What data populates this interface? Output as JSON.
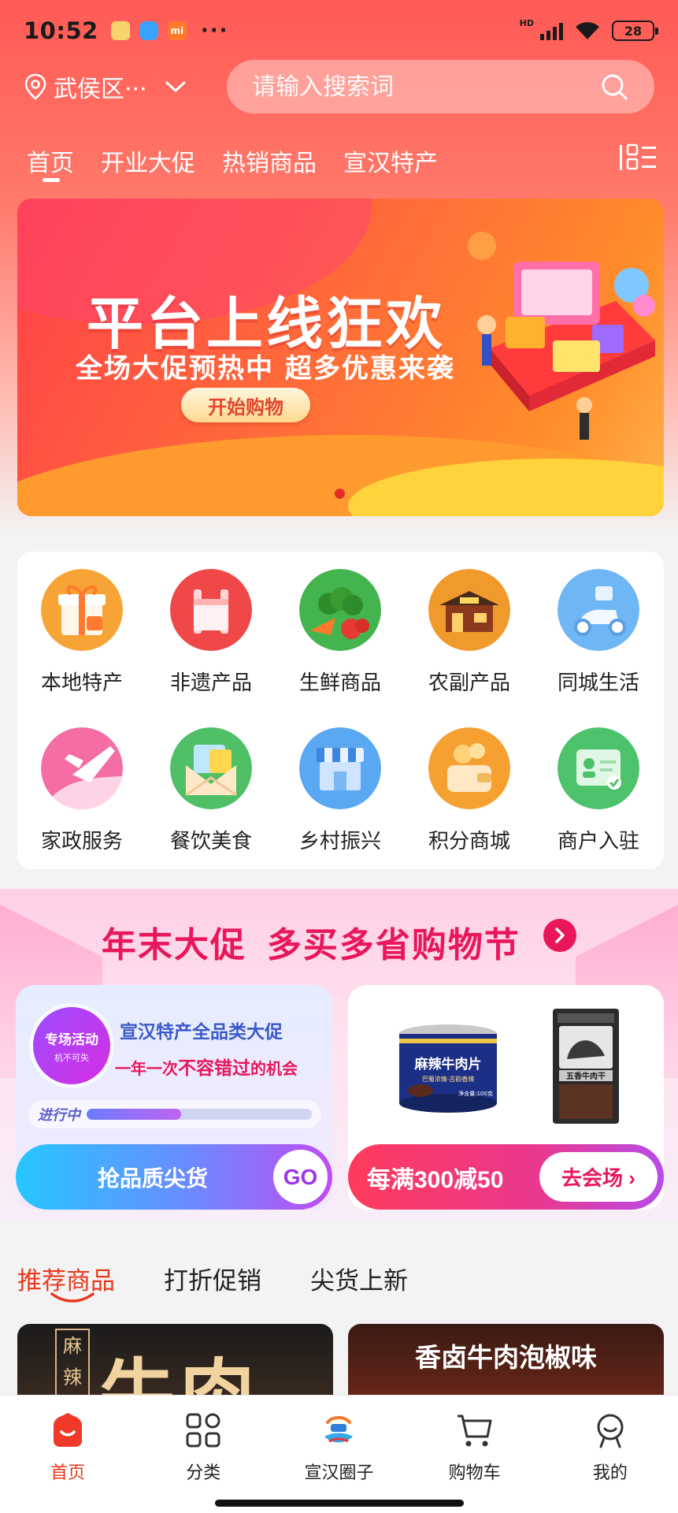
{
  "status_bar": {
    "time": "10:52",
    "network_label": "HD",
    "battery": "28",
    "more": "···"
  },
  "location": {
    "label": "武侯区···"
  },
  "search": {
    "placeholder": "请输入搜索词"
  },
  "top_tabs": [
    {
      "label": "首页",
      "active": true
    },
    {
      "label": "开业大促",
      "active": false
    },
    {
      "label": "热销商品",
      "active": false
    },
    {
      "label": "宣汉特产",
      "active": false
    }
  ],
  "banner": {
    "title": "平台上线狂欢",
    "subtitle": "全场大促预热中 超多优惠来袭",
    "button": "开始购物",
    "slide_indicator": "1"
  },
  "categories": [
    {
      "label": "本地特产",
      "icon": "gift-box-icon",
      "color": "#f7a436"
    },
    {
      "label": "非遗产品",
      "icon": "bamboo-basket-icon",
      "color": "#f04848"
    },
    {
      "label": "生鲜商品",
      "icon": "vegetables-icon",
      "color": "#43b44e"
    },
    {
      "label": "农副产品",
      "icon": "store-icon",
      "color": "#f19a2c"
    },
    {
      "label": "同城生活",
      "icon": "scooter-icon",
      "color": "#6fb6f5"
    },
    {
      "label": "家政服务",
      "icon": "airplane-icon",
      "color": "#f46da5"
    },
    {
      "label": "餐饮美食",
      "icon": "envelope-icon",
      "color": "#4fc066"
    },
    {
      "label": "乡村振兴",
      "icon": "shop-icon",
      "color": "#5aa8f2"
    },
    {
      "label": "积分商城",
      "icon": "coins-wallet-icon",
      "color": "#f5a031"
    },
    {
      "label": "商户入驻",
      "icon": "merchant-card-icon",
      "color": "#4cc36a"
    }
  ],
  "promo": {
    "headline_part1": "年末大促",
    "headline_part2": "多买多省购物节",
    "left_card": {
      "badge_title": "专场活动",
      "badge_subtitle": "机不可失",
      "title": "宣汉特产全品类大促",
      "subtitle_part1": "一年一次",
      "subtitle_emphasis": "不容错过",
      "subtitle_part2": "的机会",
      "progress_label": "进行中",
      "progress": 0.42,
      "button": "抢品质尖货",
      "go": "GO"
    },
    "right_card": {
      "can_label": "麻辣牛肉片",
      "can_sub": "巴蜀浓情·古韵香辣",
      "can_weight": "净含量:100克",
      "pack_label": "五香牛肉干",
      "button": "每满300减50",
      "goto": "去会场 ›"
    }
  },
  "recommend_tabs": [
    {
      "label": "推荐商品",
      "active": true
    },
    {
      "label": "打折促销",
      "active": false
    },
    {
      "label": "尖货上新",
      "active": false
    }
  ],
  "feed": {
    "left_tag": "麻辣",
    "left_title": "牛肉片",
    "right_title": "香卤牛肉泡椒味"
  },
  "bottom_nav": [
    {
      "label": "首页",
      "icon": "home-icon",
      "active": true
    },
    {
      "label": "分类",
      "icon": "grid-icon",
      "active": false
    },
    {
      "label": "宣汉圈子",
      "icon": "community-logo-icon",
      "active": false
    },
    {
      "label": "购物车",
      "icon": "cart-icon",
      "active": false
    },
    {
      "label": "我的",
      "icon": "profile-icon",
      "active": false
    }
  ],
  "colors": {
    "accent": "#e8391c",
    "header_top": "#ff5a55",
    "promo_pink": "#e8175a"
  }
}
